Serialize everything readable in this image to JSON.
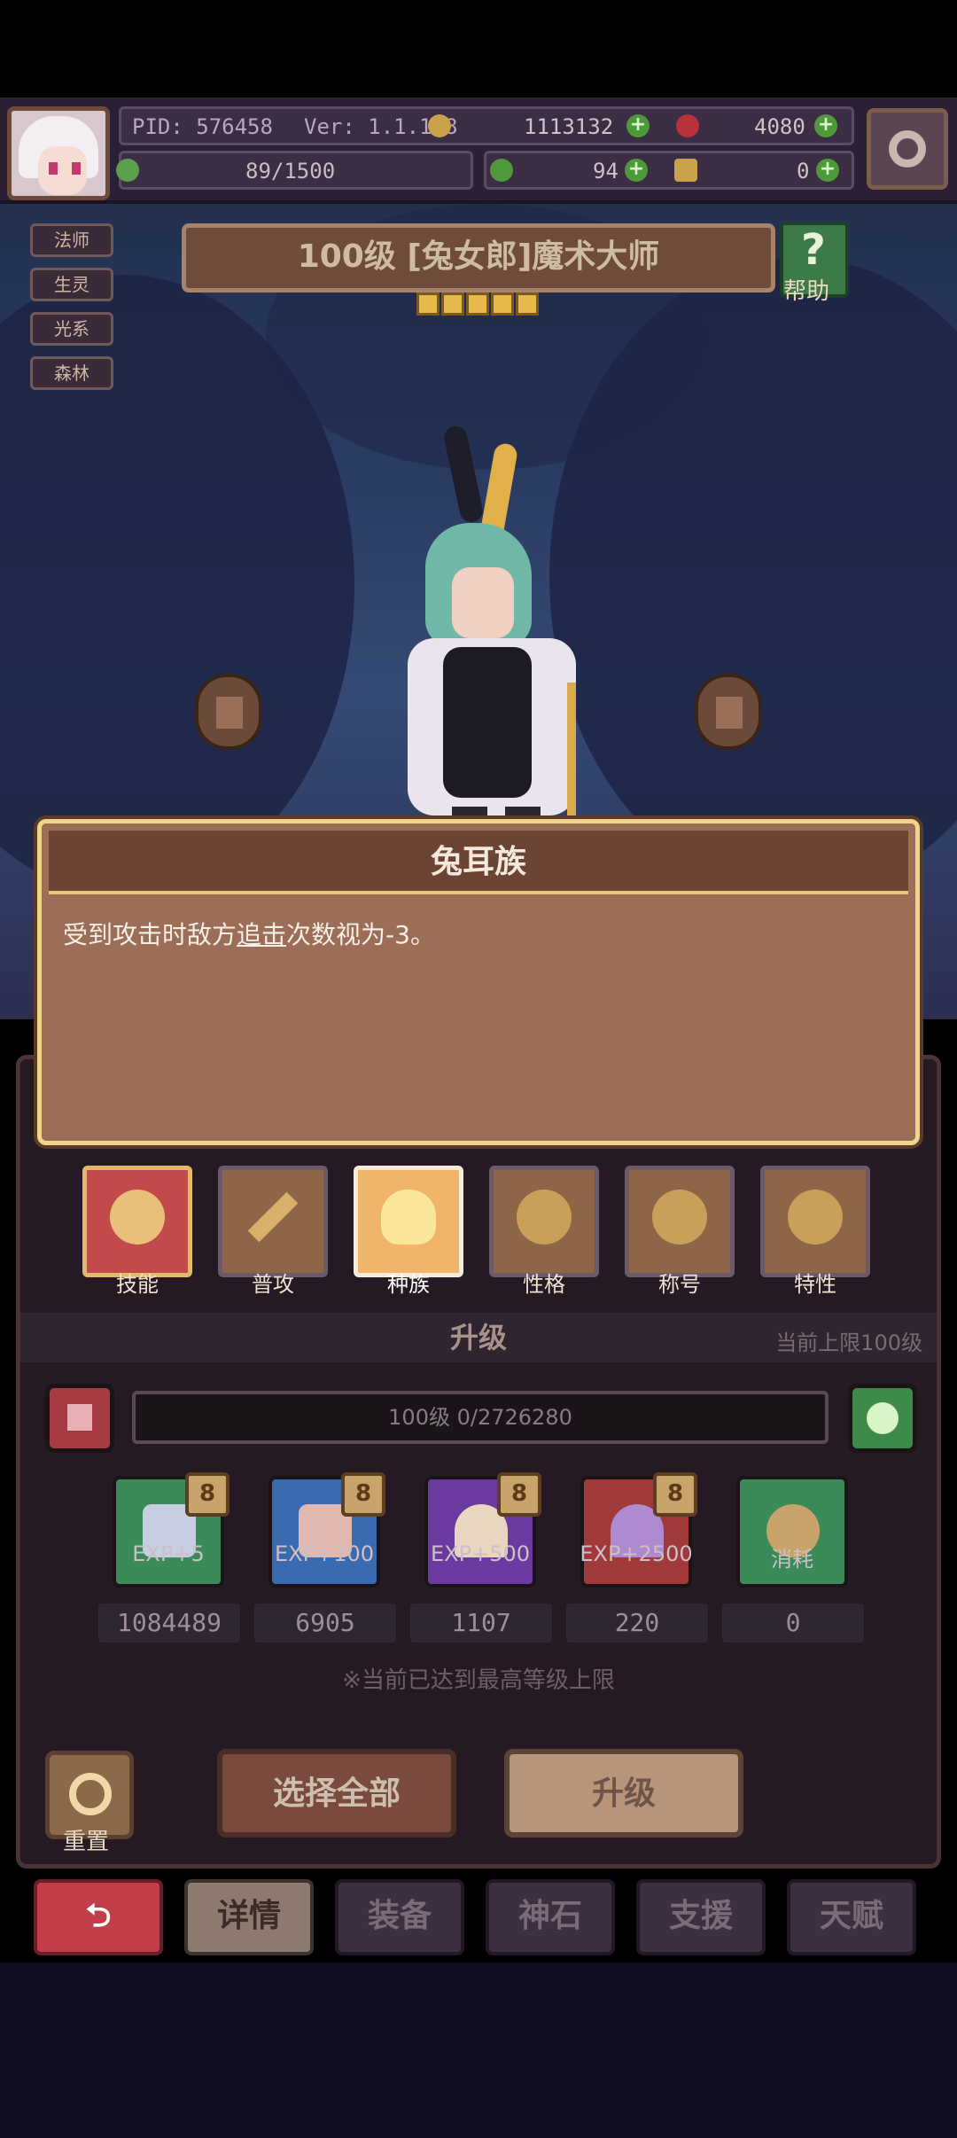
{
  "header": {
    "pid": "PID: 576458",
    "version": "Ver: 1.1.1.8",
    "gold": "1113132",
    "gems": "4080",
    "stamina": "89/1500",
    "clover": "94",
    "other": "0",
    "accent_color": "#4e9a3a"
  },
  "tags": [
    "法师",
    "生灵",
    "光系",
    "森林"
  ],
  "character": {
    "title": "100级 [兔女郎]魔术大师",
    "stars": 5,
    "help_label": "帮助"
  },
  "tooltip": {
    "title": "兔耳族",
    "text_before": "受到攻击时敌方",
    "text_link": "追击",
    "text_after": "次数视为-3。"
  },
  "tabs": [
    {
      "label": "技能",
      "icon": "skill-icon"
    },
    {
      "label": "普攻",
      "icon": "sword-icon"
    },
    {
      "label": "种族",
      "icon": "rabbit-icon"
    },
    {
      "label": "性格",
      "icon": "plus-icon"
    },
    {
      "label": "称号",
      "icon": "plus-icon"
    },
    {
      "label": "特性",
      "icon": "plus-icon"
    }
  ],
  "upgrade": {
    "title": "升级",
    "limit": "当前上限100级",
    "progress_text": "100级 0/2726280",
    "items": [
      {
        "label": "EXP+5",
        "badge": "8",
        "count": "1084489",
        "color": "#3a8a5a"
      },
      {
        "label": "EXP+100",
        "badge": "8",
        "count": "6905",
        "color": "#3a6ab0"
      },
      {
        "label": "EXP+500",
        "badge": "8",
        "count": "1107",
        "color": "#6a3aa0"
      },
      {
        "label": "EXP+2500",
        "badge": "8",
        "count": "220",
        "color": "#a03a3a"
      },
      {
        "label": "消耗",
        "badge": "",
        "count": "0",
        "color": "#3a8a5a"
      }
    ],
    "notice": "※当前已达到最高等级上限",
    "select_all": "选择全部",
    "upgrade_btn": "升级",
    "reset_label": "重置"
  },
  "bottom_nav": {
    "back_icon": "back-arrow-icon",
    "details": "详情",
    "equipment": "装备",
    "divine_stone": "神石",
    "support": "支援",
    "talent": "天赋"
  }
}
